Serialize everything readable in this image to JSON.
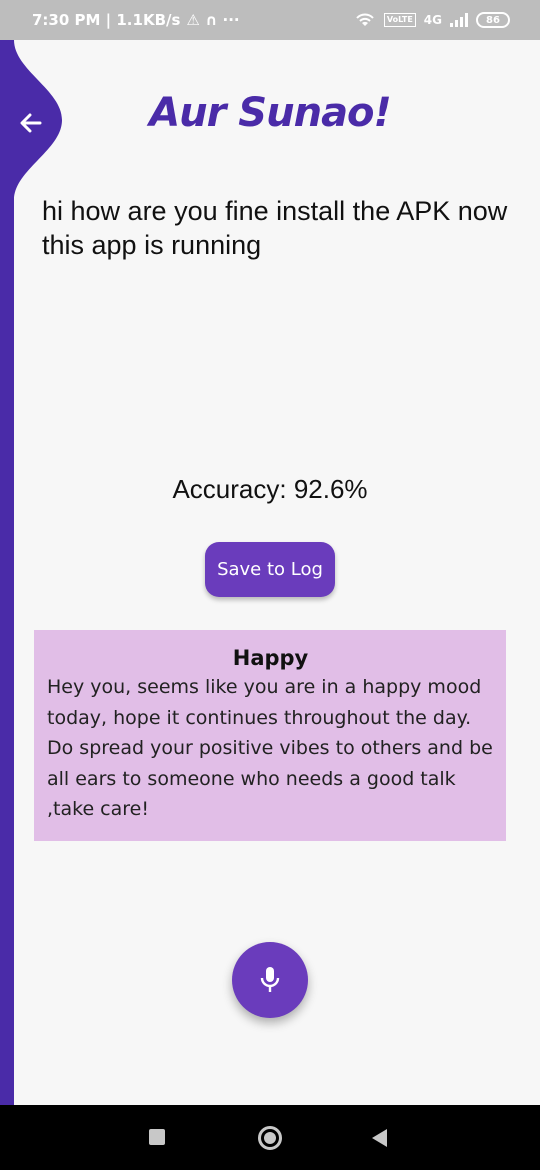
{
  "status_bar": {
    "time": "7:30 PM | 1.1KB/s",
    "notif_icons": "⚠ ∩ ···",
    "network_label": "4G",
    "lte_label": "VoLTE",
    "battery": "86"
  },
  "header": {
    "title": "Aur Sunao!"
  },
  "transcript": {
    "text": "hi how are you fine install the APK now this app is running"
  },
  "accuracy": {
    "text": "Accuracy: 92.6%"
  },
  "actions": {
    "save_label": "Save to Log"
  },
  "mood_card": {
    "title": "Happy",
    "message": "Hey you, seems like you are in a happy mood today, hope it continues throughout the day. Do spread your positive vibes to others and be all ears to someone who needs a good talk ,take care!"
  },
  "colors": {
    "accent": "#6a3cbc",
    "accent_dark": "#4a2ba8",
    "card_bg": "#e1bee7",
    "background": "#f7f7f7"
  },
  "icons": {
    "back": "arrow-left-icon",
    "mic": "microphone-icon"
  }
}
